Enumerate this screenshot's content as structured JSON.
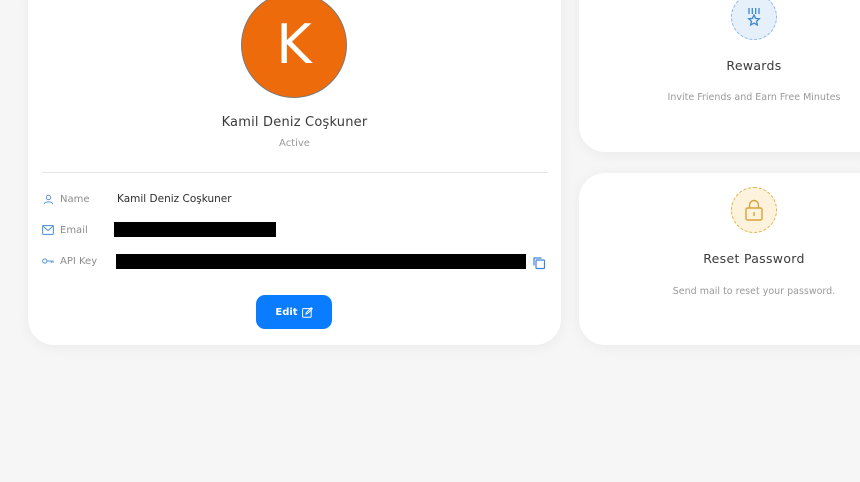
{
  "profile": {
    "avatar_letter": "K",
    "name": "Kamil Deniz Coşkuner",
    "status": "Active",
    "fields": {
      "name_label": "Name",
      "name_value": "Kamil Deniz Coşkuner",
      "email_label": "Email",
      "api_key_label": "API Key"
    },
    "edit_label": "Edit"
  },
  "rewards": {
    "title": "Rewards",
    "subtitle": "Invite Friends and Earn Free Minutes"
  },
  "reset_password": {
    "title": "Reset Password",
    "subtitle": "Send mail to reset your password."
  },
  "colors": {
    "accent": "#0a7cff",
    "avatar": "#ee6b0c",
    "lock": "#e4b24a",
    "rewards_icon": "#3c86d6"
  }
}
